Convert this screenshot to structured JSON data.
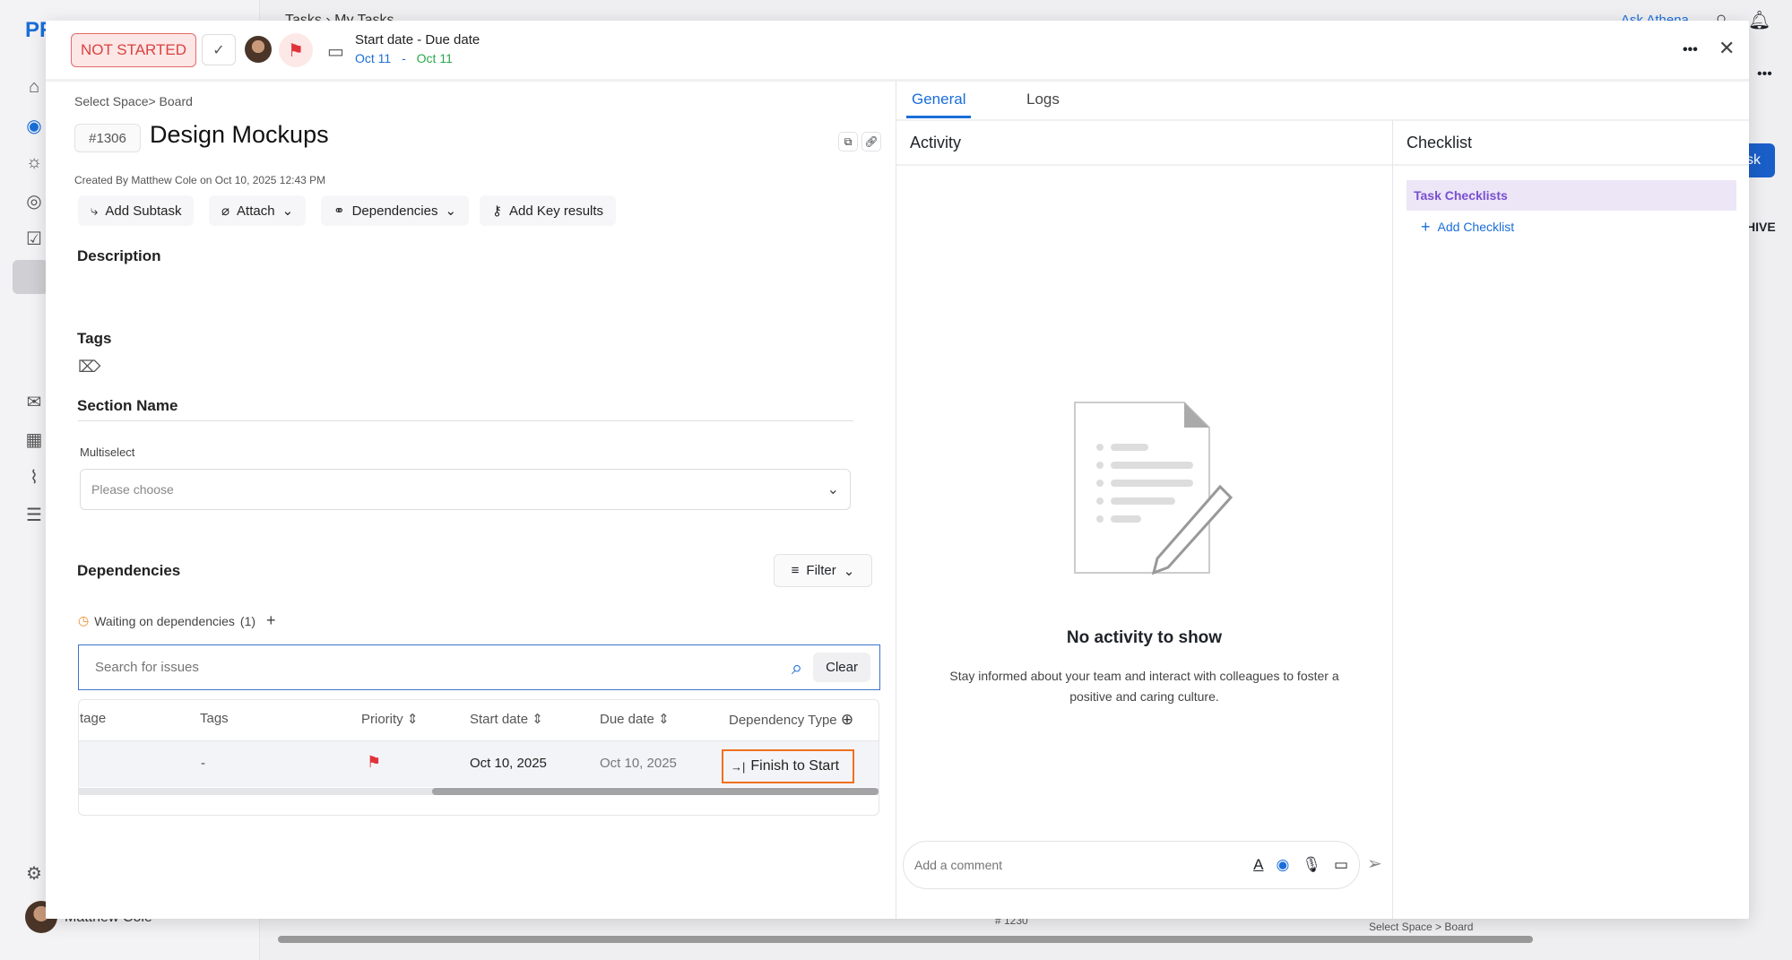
{
  "background": {
    "logo": "PR",
    "breadcrumb": "Tasks  ›  My Tasks",
    "ask": "Ask Athena",
    "user": "Matthew Cole",
    "card_id": "# 1230",
    "card_path": "Select Space > Board",
    "archive": "HIVE",
    "task_btn": "sk"
  },
  "header": {
    "status": "NOT STARTED",
    "date_label": "Start date - Due date",
    "start": "Oct 11",
    "sep": "-",
    "due": "Oct 11"
  },
  "task": {
    "breadcrumb": "Select Space> Board",
    "id": "#1306",
    "title": "Design Mockups",
    "created": "Created By Matthew Cole on Oct 10, 2025 12:43 PM"
  },
  "actions": {
    "subtask": "Add Subtask",
    "attach": "Attach",
    "deps": "Dependencies",
    "key": "Add Key results"
  },
  "sections": {
    "description": "Description",
    "tags": "Tags",
    "section_name": "Section Name",
    "multiselect": "Multiselect",
    "placeholder": "Please choose",
    "dependencies": "Dependencies",
    "filter": "Filter"
  },
  "deps": {
    "waiting": "Waiting on dependencies",
    "count": "(1)",
    "search_placeholder": "Search for issues",
    "clear": "Clear",
    "columns": [
      "tage",
      "Tags",
      "Priority",
      "Start date",
      "Due date",
      "Dependency Type"
    ],
    "row": {
      "tags": "-",
      "start": "Oct 10, 2025",
      "due": "Oct 10, 2025",
      "type": "Finish to Start"
    }
  },
  "tabs": [
    "General",
    "Logs"
  ],
  "activity": {
    "title": "Activity",
    "empty": "No activity to show",
    "desc1": "Stay informed about your team and interact with colleagues to foster a",
    "desc2": "positive and caring culture.",
    "comment_placeholder": "Add a comment"
  },
  "checklist": {
    "title": "Checklist",
    "item": "Task Checklists",
    "add": "Add Checklist"
  },
  "colors": {
    "accent": "#1a6ed8",
    "status": "#d8433f",
    "green": "#2aa84a",
    "purple": "#7a4fd0"
  }
}
